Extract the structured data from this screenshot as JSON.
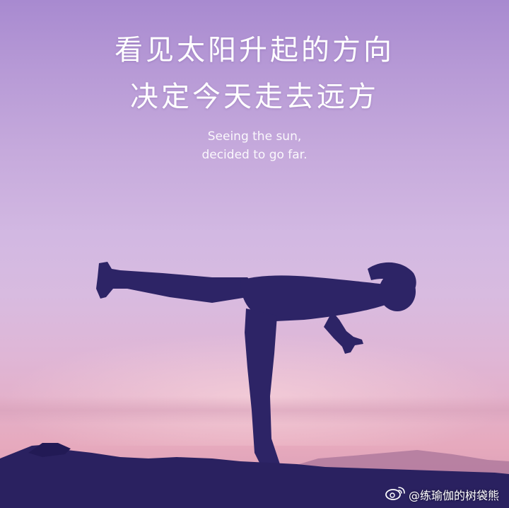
{
  "headline": {
    "line1": "看见太阳升起的方向",
    "line2": "决定今天走去远方"
  },
  "subtitle": {
    "line1": "Seeing the sun,",
    "line2": "decided to go far."
  },
  "watermark": {
    "handle": "@练瑜伽的树袋熊",
    "icon": "weibo-icon"
  },
  "colors": {
    "sky_top": "#a88ad0",
    "sky_bottom": "#e6a9bd",
    "silhouette": "#2d2466",
    "text": "#ffffff"
  }
}
